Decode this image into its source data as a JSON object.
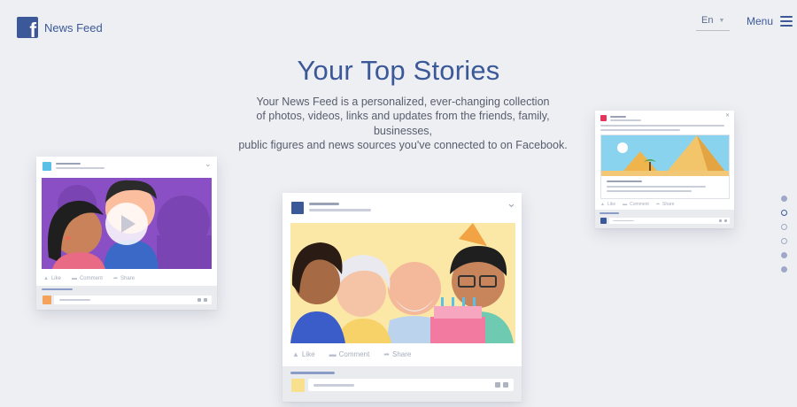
{
  "header": {
    "brand": "News Feed",
    "logo_letter": "f",
    "language": "En",
    "menu_label": "Menu"
  },
  "hero": {
    "title": "Your Top Stories",
    "description_lines": [
      "Your News Feed is a personalized, ever-changing collection",
      "of photos, videos, links and updates from the friends, family,",
      "businesses,",
      "public figures and news sources you've connected to on Facebook."
    ]
  },
  "post_actions": {
    "like": "Like",
    "comment": "Comment",
    "share": "Share"
  },
  "pager": {
    "dots": [
      "filled",
      "active",
      "ring",
      "ring",
      "filled",
      "filled"
    ]
  },
  "colors": {
    "brand_blue": "#3b5998",
    "background": "#eeeff3",
    "left_card_avatar": "#5bc0e8",
    "center_card_avatar": "#3b5998",
    "right_card_avatar": "#e5365a",
    "left_footer_square": "#f4a35a",
    "center_footer_square": "#f9e08d",
    "right_footer_square": "#3b5998"
  },
  "icons": [
    "facebook-logo",
    "chevron-down-icon",
    "hamburger-menu-icon",
    "like-icon",
    "comment-icon",
    "share-icon",
    "play-icon",
    "birthday-cake-icon"
  ]
}
